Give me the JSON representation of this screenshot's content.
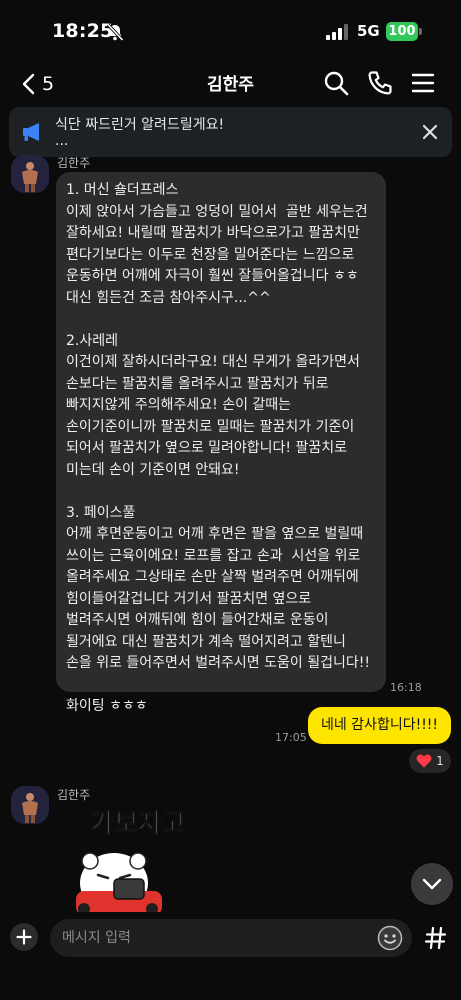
{
  "status_bar": {
    "time": "18:25",
    "network": "5G",
    "battery": "100",
    "colors": {
      "battery": "#34c759"
    }
  },
  "nav": {
    "back_count": "5",
    "title": "김한주",
    "icons": [
      "chevron-left-icon",
      "search-icon",
      "phone-icon",
      "menu-icon"
    ]
  },
  "notice": {
    "line1": "식단 짜드린거 알려드릴게요!",
    "line2": "...",
    "icons": [
      "megaphone-icon",
      "close-icon"
    ],
    "colors": {
      "megaphone": "#3b82f6"
    }
  },
  "messages": [
    {
      "sender": "김한주",
      "text": "1. 머신 숄더프레스\n이제 앉아서 가슴들고 엉덩이 밀어서  골반 세우는건 잘하세요! 내릴때 팔꿈치가 바닥으로가고 팔꿈치만 편다기보다는 이두로 천장을 밀어준다는 느낌으로 운동하면 어깨에 자극이 훨씬 잘들어올겁니다 ㅎㅎ 대신 힘든건 조금 참아주시구...^^\n\n2.사레레\n이건이제 잘하시더라구요! 대신 무게가 올라가면서 손보다는 팔꿈치를 올려주시고 팔꿈치가 뒤로 빠지지않게 주의해주세요! 손이 갈때는 손이기준이니까 팔꿈치로 밀때는 팔꿈치가 기준이 되어서 팔꿈치가 옆으로 밀려야합니다! 팔꿈치로 미는데 손이 기준이면 안돼요!\n\n3. 페이스풀\n어깨 후면운동이고 어깨 후면은 팔을 옆으로 벌릴때 쓰이는 근육이에요! 로프를 잡고 손과  시선을 위로 올려주세요 그상태로 손만 살짝 벌려주면 어깨뒤에 힘이들어갈겁니다 거기서 팔꿈치면 옆으로 벌려주시면 어깨뒤에 힘이 들어간채로 운동이 될거에요 대신 팔꿈치가 계속 떨어지려고 할텐니 손을 위로 들어주면서 벌려주시면 도움이 될겁니다!!\n\n화이팅 ㅎㅎㅎ",
      "time": "16:18"
    },
    {
      "sender": "me",
      "text": "네네 감사합니다!!!!",
      "time": "17:05",
      "reaction": {
        "icon": "heart-icon",
        "count": "1"
      },
      "colors": {
        "bubble": "#fee500"
      }
    },
    {
      "sender": "김한주",
      "sticker": {
        "caption": "가보자고",
        "icon": "bear-sticker-icon"
      }
    }
  ],
  "composer": {
    "placeholder": "메시지 입력",
    "icons": [
      "plus-icon",
      "emoji-icon",
      "hash-icon",
      "chevron-down-icon"
    ]
  }
}
